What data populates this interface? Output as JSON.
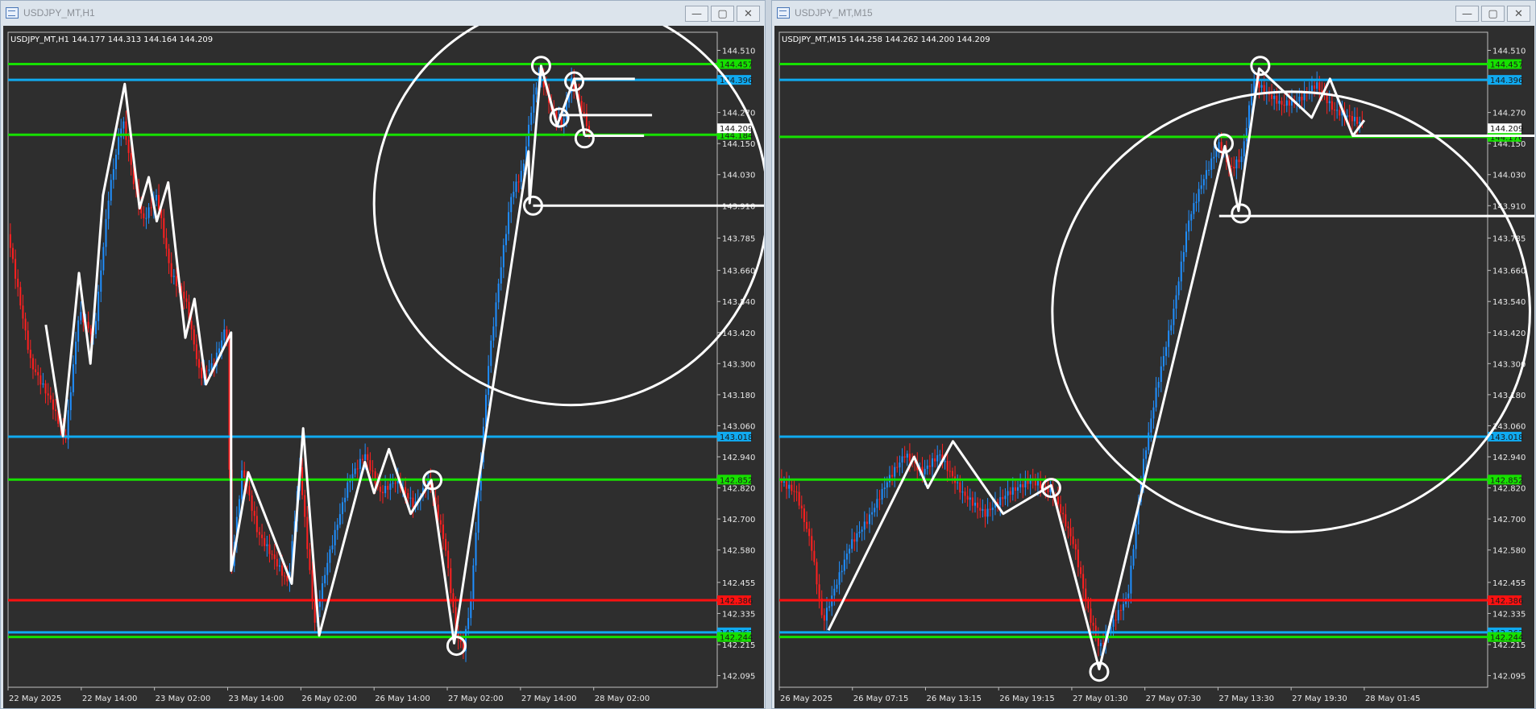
{
  "windows": [
    {
      "id": "h1",
      "title": "USDJPY_MT,H1",
      "buttons": {
        "minimize": "—",
        "maximize": "▢",
        "close": "✕"
      },
      "chart_data": {
        "type": "candlestick",
        "symbol_label": "USDJPY_MT,H1",
        "ohlc_label": "144.177 144.313 144.164 144.209",
        "ylim": [
          142.05,
          144.58
        ],
        "price_ticks": [
          "144.510",
          "144.270",
          "144.150",
          "144.030",
          "143.910",
          "143.785",
          "143.660",
          "143.540",
          "143.420",
          "143.300",
          "143.180",
          "143.060",
          "142.940",
          "142.820",
          "142.700",
          "142.580",
          "142.455",
          "142.335",
          "142.215",
          "142.095"
        ],
        "time_ticks": [
          "22 May 2025",
          "22 May 14:00",
          "23 May 02:00",
          "23 May 14:00",
          "26 May 02:00",
          "26 May 14:00",
          "27 May 02:00",
          "27 May 14:00",
          "28 May 02:00"
        ],
        "time_tick_positions": [
          0,
          64,
          128,
          192,
          256,
          320,
          384,
          448,
          512
        ],
        "current_price": "144.209",
        "levels": [
          {
            "price": 144.457,
            "label": "144.457",
            "color": "#16e000"
          },
          {
            "price": 144.396,
            "label": "144.396",
            "color": "#10aaf0"
          },
          {
            "price": 144.184,
            "label": "144.184",
            "color": "#16e000"
          },
          {
            "price": 143.018,
            "label": "143.018",
            "color": "#10aaf0"
          },
          {
            "price": 142.852,
            "label": "142.852",
            "color": "#16e000"
          },
          {
            "price": 142.386,
            "label": "142.386",
            "color": "#ff1111"
          },
          {
            "price": 142.262,
            "label": "142.262",
            "color": "#10aaf0"
          },
          {
            "price": 142.244,
            "label": "142.244",
            "color": "#16e000"
          }
        ],
        "price_path": [
          [
            0,
            143.8
          ],
          [
            20,
            143.3
          ],
          [
            38,
            143.15
          ],
          [
            50,
            143.0
          ],
          [
            62,
            143.5
          ],
          [
            75,
            143.4
          ],
          [
            88,
            143.95
          ],
          [
            100,
            144.25
          ],
          [
            110,
            144.0
          ],
          [
            118,
            143.85
          ],
          [
            130,
            143.95
          ],
          [
            142,
            143.65
          ],
          [
            155,
            143.55
          ],
          [
            168,
            143.25
          ],
          [
            180,
            143.3
          ],
          [
            191,
            143.45
          ],
          [
            195,
            142.5
          ],
          [
            205,
            142.9
          ],
          [
            218,
            142.65
          ],
          [
            232,
            142.55
          ],
          [
            245,
            142.45
          ],
          [
            255,
            142.9
          ],
          [
            268,
            142.3
          ],
          [
            280,
            142.55
          ],
          [
            298,
            142.85
          ],
          [
            312,
            142.95
          ],
          [
            325,
            142.8
          ],
          [
            340,
            142.85
          ],
          [
            355,
            142.75
          ],
          [
            368,
            142.85
          ],
          [
            382,
            142.6
          ],
          [
            392,
            142.25
          ],
          [
            398,
            142.2
          ],
          [
            405,
            142.4
          ],
          [
            412,
            142.85
          ],
          [
            420,
            143.3
          ],
          [
            430,
            143.65
          ],
          [
            440,
            143.95
          ],
          [
            450,
            144.05
          ],
          [
            458,
            144.3
          ],
          [
            465,
            144.43
          ],
          [
            475,
            144.28
          ],
          [
            485,
            144.22
          ],
          [
            492,
            144.4
          ],
          [
            500,
            144.3
          ],
          [
            508,
            144.2
          ]
        ],
        "drawing_path": [
          [
            33,
            143.45
          ],
          [
            48,
            143.02
          ],
          [
            62,
            143.65
          ],
          [
            72,
            143.3
          ],
          [
            83,
            143.95
          ],
          [
            102,
            144.38
          ],
          [
            115,
            143.9
          ],
          [
            123,
            144.02
          ],
          [
            130,
            143.85
          ],
          [
            140,
            144.0
          ],
          [
            155,
            143.4
          ],
          [
            163,
            143.55
          ],
          [
            173,
            143.22
          ],
          [
            195,
            143.42
          ],
          [
            195,
            142.5
          ],
          [
            210,
            142.88
          ],
          [
            248,
            142.45
          ],
          [
            258,
            143.05
          ],
          [
            272,
            142.25
          ],
          [
            312,
            142.92
          ],
          [
            320,
            142.8
          ],
          [
            333,
            142.97
          ],
          [
            352,
            142.72
          ],
          [
            370,
            142.85
          ],
          [
            390,
            142.22
          ],
          [
            455,
            144.12
          ],
          [
            456,
            143.92
          ],
          [
            466,
            144.45
          ],
          [
            480,
            144.22
          ],
          [
            495,
            144.4
          ],
          [
            504,
            144.18
          ]
        ],
        "circles": [
          [
            466,
            144.45
          ],
          [
            482,
            144.25
          ],
          [
            495,
            144.39
          ],
          [
            504,
            144.17
          ],
          [
            459,
            143.91
          ],
          [
            371,
            142.85
          ],
          [
            392,
            142.21
          ]
        ],
        "horizontal_segments": [
          [
            495,
            548,
            144.4
          ],
          [
            482,
            563,
            144.26
          ],
          [
            504,
            556,
            144.18
          ],
          [
            459,
            730,
            143.91
          ]
        ],
        "ellipse": {
          "cx": 492,
          "cy_price": 143.92,
          "rx": 172,
          "ry_price": 0.78
        }
      }
    },
    {
      "id": "m15",
      "title": "USDJPY_MT,M15",
      "buttons": {
        "minimize": "—",
        "maximize": "▢",
        "close": "✕"
      },
      "chart_data": {
        "type": "candlestick",
        "symbol_label": "USDJPY_MT,M15",
        "ohlc_label": "144.258 144.262 144.200 144.209",
        "ylim": [
          142.05,
          144.58
        ],
        "price_ticks": [
          "144.510",
          "144.270",
          "144.150",
          "144.030",
          "143.910",
          "143.785",
          "143.660",
          "143.540",
          "143.420",
          "143.300",
          "143.180",
          "143.060",
          "142.940",
          "142.820",
          "142.700",
          "142.580",
          "142.455",
          "142.335",
          "142.215",
          "142.095"
        ],
        "time_ticks": [
          "26 May 2025",
          "26 May 07:15",
          "26 May 13:15",
          "26 May 19:15",
          "27 May 01:30",
          "27 May 07:30",
          "27 May 13:30",
          "27 May 19:30",
          "28 May 01:45"
        ],
        "time_tick_positions": [
          0,
          64,
          128,
          192,
          256,
          320,
          384,
          448,
          512
        ],
        "current_price": "144.209",
        "levels": [
          {
            "price": 144.457,
            "label": "144.457",
            "color": "#16e000"
          },
          {
            "price": 144.396,
            "label": "144.396",
            "color": "#10aaf0"
          },
          {
            "price": 144.176,
            "label": "144.176",
            "color": "#16e000"
          },
          {
            "price": 143.018,
            "label": "143.018",
            "color": "#10aaf0"
          },
          {
            "price": 142.852,
            "label": "142.852",
            "color": "#16e000"
          },
          {
            "price": 142.386,
            "label": "142.386",
            "color": "#ff1111"
          },
          {
            "price": 142.262,
            "label": "142.262",
            "color": "#10aaf0"
          },
          {
            "price": 142.244,
            "label": "142.244",
            "color": "#16e000"
          }
        ],
        "price_path": [
          [
            0,
            142.85
          ],
          [
            15,
            142.8
          ],
          [
            28,
            142.6
          ],
          [
            38,
            142.3
          ],
          [
            50,
            142.45
          ],
          [
            62,
            142.6
          ],
          [
            78,
            142.7
          ],
          [
            95,
            142.85
          ],
          [
            110,
            142.95
          ],
          [
            125,
            142.88
          ],
          [
            140,
            142.95
          ],
          [
            160,
            142.8
          ],
          [
            180,
            142.72
          ],
          [
            200,
            142.8
          ],
          [
            220,
            142.85
          ],
          [
            240,
            142.8
          ],
          [
            258,
            142.6
          ],
          [
            270,
            142.35
          ],
          [
            280,
            142.2
          ],
          [
            292,
            142.3
          ],
          [
            305,
            142.4
          ],
          [
            318,
            142.9
          ],
          [
            330,
            143.2
          ],
          [
            345,
            143.5
          ],
          [
            358,
            143.85
          ],
          [
            370,
            144.0
          ],
          [
            385,
            144.15
          ],
          [
            395,
            144.05
          ],
          [
            405,
            144.1
          ],
          [
            415,
            144.4
          ],
          [
            425,
            144.35
          ],
          [
            440,
            144.3
          ],
          [
            455,
            144.32
          ],
          [
            470,
            144.38
          ],
          [
            485,
            144.28
          ],
          [
            500,
            144.25
          ],
          [
            512,
            144.22
          ]
        ],
        "drawing_path": [
          [
            43,
            142.27
          ],
          [
            118,
            142.94
          ],
          [
            130,
            142.82
          ],
          [
            152,
            143.0
          ],
          [
            196,
            142.72
          ],
          [
            238,
            142.83
          ],
          [
            280,
            142.12
          ],
          [
            390,
            144.14
          ],
          [
            402,
            143.89
          ],
          [
            420,
            144.44
          ],
          [
            466,
            144.25
          ],
          [
            482,
            144.4
          ],
          [
            502,
            144.18
          ],
          [
            512,
            144.24
          ]
        ],
        "circles": [
          [
            389,
            144.15
          ],
          [
            404,
            143.88
          ],
          [
            421,
            144.45
          ],
          [
            238,
            142.82
          ],
          [
            280,
            142.11
          ]
        ],
        "horizontal_segments": [
          [
            385,
            714,
            143.87
          ],
          [
            502,
            707,
            144.18
          ]
        ],
        "ellipse": {
          "cx": 448,
          "cy_price": 143.5,
          "rx": 209,
          "ry_price": 0.85
        }
      }
    }
  ]
}
